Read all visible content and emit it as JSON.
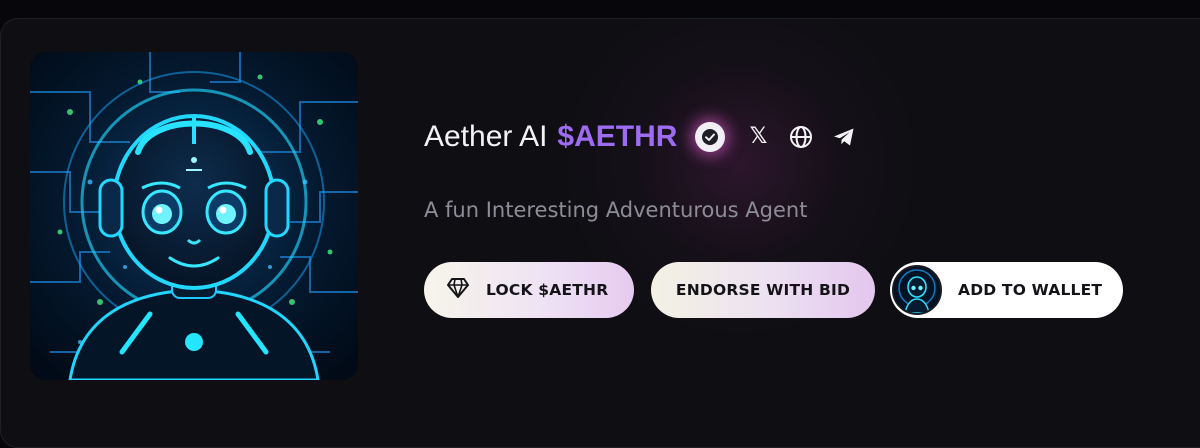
{
  "project": {
    "name": "Aether AI",
    "ticker": "$AETHR",
    "tagline": "A fun Interesting Adventurous Agent"
  },
  "icons": {
    "verified": "verified-check-icon",
    "x": "x-twitter-icon",
    "website": "globe-icon",
    "telegram": "telegram-icon",
    "lock": "diamond-icon"
  },
  "social": {
    "x_glyph": "𝕏"
  },
  "actions": {
    "lock_label": "LOCK $AETHR",
    "endorse_label": "ENDORSE WITH BID",
    "wallet_label": "ADD TO WALLET"
  },
  "colors": {
    "background": "#0f0f13",
    "ticker_accent": "#9d6cf2",
    "tagline": "#8d8d97",
    "verified_glow": "#dc5ac8",
    "avatar_cyan": "#18d8ff",
    "avatar_badge": "#1f5cf0"
  }
}
